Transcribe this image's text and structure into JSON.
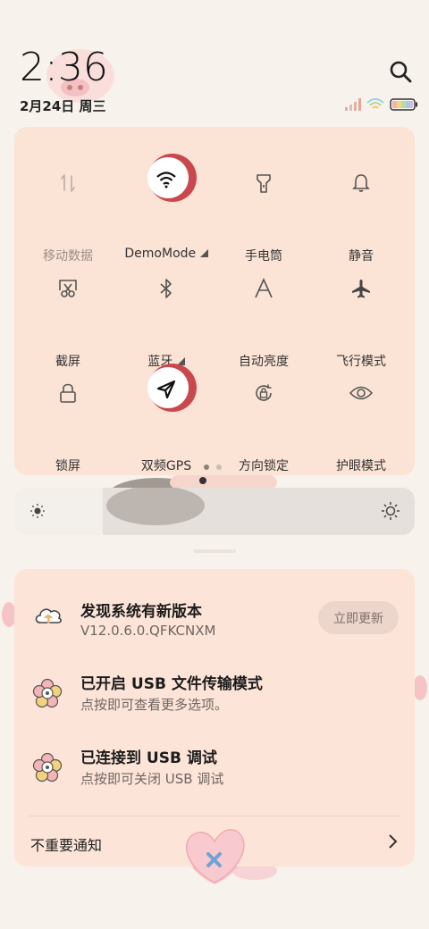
{
  "status": {
    "time": "2:36",
    "date": "2月24日 周三"
  },
  "quick_settings": {
    "tiles": [
      {
        "label": "移动数据",
        "icon": "mobile-data-icon",
        "active": false
      },
      {
        "label": "DemoMode",
        "icon": "wifi-icon",
        "active": true,
        "has_menu": true
      },
      {
        "label": "手电筒",
        "icon": "flashlight-icon",
        "active": false
      },
      {
        "label": "静音",
        "icon": "bell-icon",
        "active": false
      },
      {
        "label": "截屏",
        "icon": "screenshot-icon",
        "active": false
      },
      {
        "label": "蓝牙",
        "icon": "bluetooth-icon",
        "active": false,
        "has_menu": true
      },
      {
        "label": "自动亮度",
        "icon": "auto-brightness-icon",
        "active": false
      },
      {
        "label": "飞行模式",
        "icon": "airplane-icon",
        "active": false
      },
      {
        "label": "锁屏",
        "icon": "lock-icon",
        "active": false
      },
      {
        "label": "双频GPS",
        "icon": "location-arrow-icon",
        "active": true
      },
      {
        "label": "方向锁定",
        "icon": "rotation-lock-icon",
        "active": false
      },
      {
        "label": "护眼模式",
        "icon": "eye-icon",
        "active": false
      }
    ],
    "page_count": 2,
    "current_page": 1
  },
  "brightness": {
    "level_fraction": 0.22
  },
  "notifications": [
    {
      "title": "发现系统有新版本",
      "subtitle": "V12.0.6.0.QFKCNXM",
      "icon": "cloud-update-icon",
      "action": "立即更新"
    },
    {
      "title": "已开启 USB 文件传输模式",
      "subtitle": "点按即可查看更多选项。",
      "icon": "flower-settings-icon"
    },
    {
      "title": "已连接到 USB 调试",
      "subtitle": "点按即可关闭 USB 调试",
      "icon": "flower-settings-icon"
    }
  ],
  "unimportant_label": "不重要通知",
  "colors": {
    "background": "#f8f2ec",
    "panel": "#fbe3d5",
    "active_tile": "#c9484d"
  }
}
